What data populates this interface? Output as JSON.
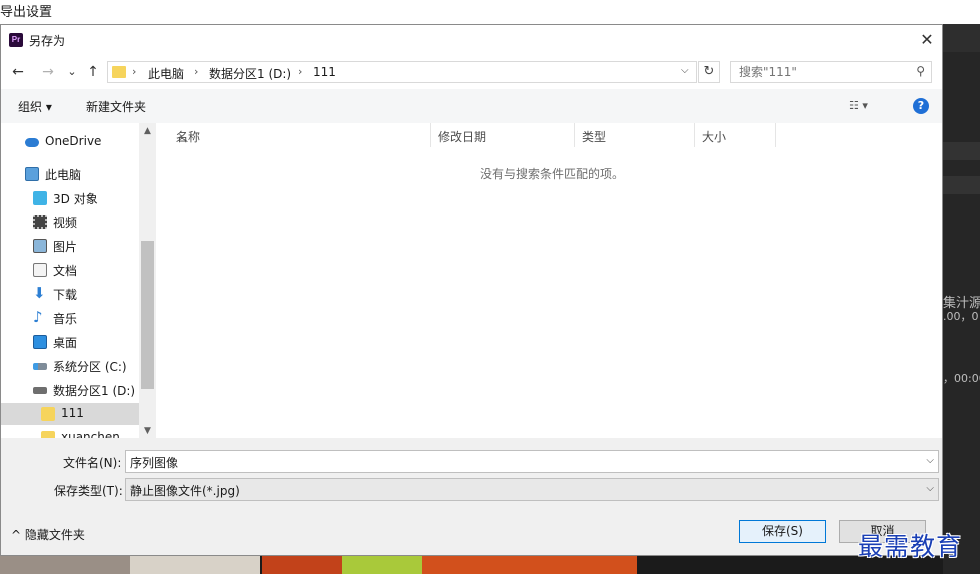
{
  "background_app": {
    "title": "导出设置",
    "right_panel_text": [
      "集汁源",
      ".00，0",
      "，00:00"
    ]
  },
  "dialog": {
    "title": "另存为",
    "app_icon_text": "Pr",
    "close_glyph": "✕",
    "nav": {
      "back": "←",
      "forward": "→",
      "recent": "⌄",
      "up": "↑"
    },
    "breadcrumb": [
      "此电脑",
      "数据分区1 (D:)",
      "111"
    ],
    "search_placeholder": "搜索\"111\"",
    "toolbar": {
      "organize": "组织 ▾",
      "new_folder": "新建文件夹",
      "help": "?"
    },
    "sidebar": [
      {
        "label": "OneDrive",
        "icon": "cloud-icon"
      },
      {
        "label": "此电脑",
        "icon": "computer-icon"
      },
      {
        "label": "3D 对象",
        "icon": "cube-icon"
      },
      {
        "label": "视频",
        "icon": "video-icon"
      },
      {
        "label": "图片",
        "icon": "picture-icon"
      },
      {
        "label": "文档",
        "icon": "document-icon"
      },
      {
        "label": "下载",
        "icon": "download-icon"
      },
      {
        "label": "音乐",
        "icon": "music-icon"
      },
      {
        "label": "桌面",
        "icon": "desktop-icon"
      },
      {
        "label": "系统分区 (C:)",
        "icon": "drive-c-icon"
      },
      {
        "label": "数据分区1 (D:)",
        "icon": "drive-d-icon"
      },
      {
        "label": "111",
        "icon": "folder-icon",
        "selected": true
      },
      {
        "label": "xuanchen",
        "icon": "folder-icon"
      }
    ],
    "columns": [
      "名称",
      "修改日期",
      "类型",
      "大小"
    ],
    "empty_message": "没有与搜索条件匹配的项。",
    "form": {
      "filename_label": "文件名(N):",
      "filename_value": "序列图像",
      "filetype_label": "保存类型(T):",
      "filetype_value": "静止图像文件(*.jpg)",
      "hide_folders": "隐藏文件夹",
      "save": "保存(S)",
      "cancel": "取消"
    }
  },
  "watermark": "最需教育",
  "colors": {
    "accent": "#0078d7",
    "help_blue": "#1f6fd6",
    "selected_bg": "#d9d9d9",
    "watermark": "#1a3fb5"
  }
}
